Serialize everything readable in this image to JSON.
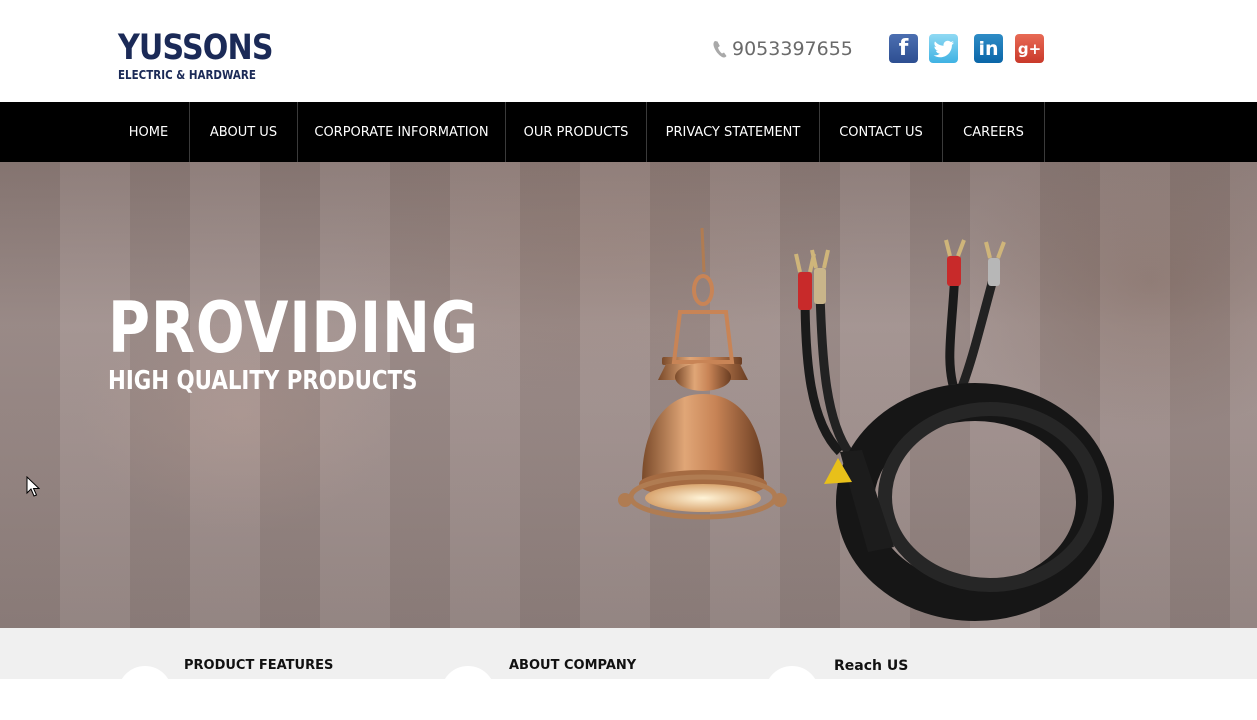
{
  "brand": {
    "name": "YUSSONS",
    "tagline": "ELECTRIC & HARDWARE",
    "color": "#1b2a57"
  },
  "contact": {
    "phone": "9053397655",
    "phone_icon": "phone-icon"
  },
  "social": {
    "facebook": "f",
    "twitter_icon": "twitter-bird-icon",
    "linkedin": "in",
    "googleplus": "g+"
  },
  "nav": {
    "items": [
      {
        "label": "HOME"
      },
      {
        "label": "ABOUT US"
      },
      {
        "label": "CORPORATE INFORMATION"
      },
      {
        "label": "OUR PRODUCTS"
      },
      {
        "label": "PRIVACY STATEMENT"
      },
      {
        "label": "CONTACT US"
      },
      {
        "label": "CAREERS"
      }
    ]
  },
  "hero": {
    "title": "PROVIDING",
    "subtitle": "HIGH QUALITY PRODUCTS",
    "products": [
      "copper-pendant-lamp-icon",
      "speaker-cable-icon"
    ]
  },
  "features": {
    "items": [
      {
        "title": "PRODUCT FEATURES"
      },
      {
        "title": "ABOUT COMPANY"
      },
      {
        "title": "Reach US"
      }
    ]
  }
}
